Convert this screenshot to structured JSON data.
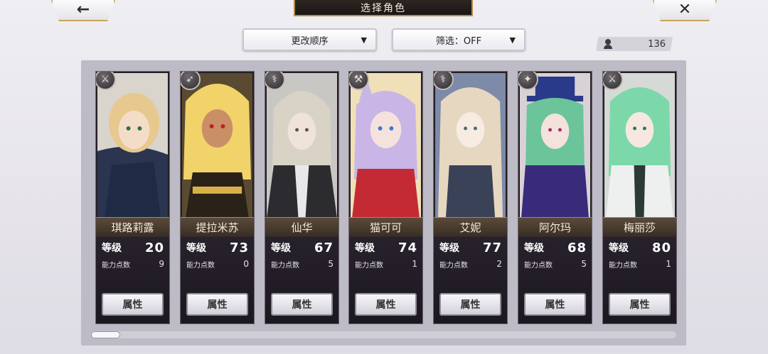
{
  "header": {
    "title": "选择角色",
    "back_icon": "←",
    "close_icon": "✕"
  },
  "controls": {
    "sort_label": "更改顺序",
    "filter_label": "筛选：OFF",
    "character_count": "136"
  },
  "stat_labels": {
    "level": "等级",
    "points": "能力点数",
    "attr_button": "属性"
  },
  "characters": [
    {
      "name": "琪路莉露",
      "level": "20",
      "points": "9",
      "class_icon": "⚔"
    },
    {
      "name": "提拉米苏",
      "level": "73",
      "points": "0",
      "class_icon": "➶"
    },
    {
      "name": "仙华",
      "level": "67",
      "points": "5",
      "class_icon": "⚕"
    },
    {
      "name": "猫可可",
      "level": "74",
      "points": "1",
      "class_icon": "⚒"
    },
    {
      "name": "艾妮",
      "level": "77",
      "points": "2",
      "class_icon": "⚕"
    },
    {
      "name": "阿尔玛",
      "level": "68",
      "points": "5",
      "class_icon": "✦"
    },
    {
      "name": "梅丽莎",
      "level": "80",
      "points": "1",
      "class_icon": "⚔"
    }
  ],
  "colors": {
    "accent_gold": "#c9a45a",
    "plate_brown": "#4a3c30"
  }
}
